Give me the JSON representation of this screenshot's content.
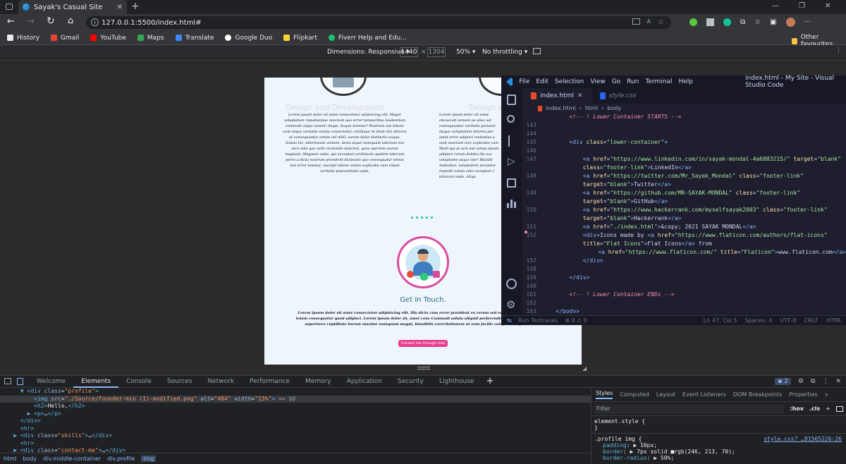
{
  "browser": {
    "tab_title": "Sayak's Casual Site",
    "url": "127.0.0.1:5500/index.html#",
    "bookmarks": [
      "History",
      "Gmail",
      "YouTube",
      "Maps",
      "Translate",
      "Google Duo",
      "Flipkart",
      "Fiverr Help and Edu..."
    ],
    "other_favourites": "Other favourites"
  },
  "device_toolbar": {
    "dimensions": "Dimensions: Responsive",
    "width": "1440",
    "times": "×",
    "height": "1304",
    "zoom": "50%",
    "throttling": "No throttling"
  },
  "page": {
    "card_title": "Design and Development",
    "card_title_right": "Design and",
    "card_text": "Lorem ipsum dolor sit amet consectetur adipisicing elit. Magni voluptatum repudiandae nesciunt quo error temporibus laudantium commodi atque autem! Sequi, itaque tenetur? Nostrum aut labore sunt atque veritatis soluta consectetur, similique in illum nisi dolores ut consequuntur omnis vel nihil, earum dolor distinctio eaque. Soluta hic, laboriosam veniam, dicta atque numquam laborum eos vero odio quo velit reiciendis dolorem, quos aperiam earum magnam. Magnam optio, qui excepturi architecto quidem laborum porro a dicta nostrum provident distinctio quo consequatur omnis nisi error tenetur, suscipit labore soluta explicabo cum totam veritatis praesentium unde.",
    "card_text_right": "Lorem ipsum dolor sit amet obcaecati veniam ea alias sol consequuntur veritatis pariatur itaque voluptatum dolores per amet error adipisci molestias a sunt nesciunt iure explicabo cum Modi qui at iure aut soluta ipsum adipisci rerum debitis illo exc voluptates atque iste? Blandit molestias, voluptatem providen impedit soluta odio excepturi r laborum unde. Aliqu",
    "contact_title": "Get In Touch.",
    "contact_text": "Lorem ipsum dolor sit amet consectetur adipisicing elit. Illo dicta cum error provident ea rerum sed eos ipsa, suscipit laborum totam consequatur quod adipisci. Lorem ipsum dolor sit, amet cons Commodi soluta aliquid perferendis aut, eos enim provident, asperiores cupiditate harum maxime numquam magni, blanditiis exercitationem ut eum facilis voluptatum ipsum dolor.",
    "contact_button": "Contact me through mail"
  },
  "vscode": {
    "menu": [
      "File",
      "Edit",
      "Selection",
      "View",
      "Go",
      "Run",
      "Terminal",
      "Help"
    ],
    "title": "index.html - My Site - Visual Studio Code",
    "tabs": [
      "index.html",
      "style.css"
    ],
    "breadcrumb": [
      "index.html",
      "html",
      "body"
    ],
    "lines": [
      {
        "n": "",
        "html": "<span class=\"cmt\">&lt;!-- ! Lower Container STARTS --&gt;</span>",
        "indent": 4
      },
      {
        "n": "143",
        "html": "",
        "indent": 0
      },
      {
        "n": "144",
        "html": "",
        "indent": 0
      },
      {
        "n": "145",
        "html": "<span class=\"tag\">&lt;div</span> <span class=\"attr\">class</span>=<span class=\"str\">\"lower-container\"</span><span class=\"tag\">&gt;</span>",
        "indent": 4
      },
      {
        "n": "146",
        "html": "",
        "indent": 0
      },
      {
        "n": "147",
        "html": "<span class=\"tag\">&lt;a</span> <span class=\"attr\">href</span>=<span class=\"str\">\"https://www.linkedin.com/in/sayak-mondal-4a6883215/\"</span> <span class=\"attr\">target</span>=<span class=\"str\">\"blank\"</span>",
        "indent": 6
      },
      {
        "n": "",
        "html": "<span class=\"attr\">class</span>=<span class=\"str\">\"footer-link\"</span><span class=\"tag\">&gt;</span>LinkedIn<span class=\"tag\">&lt;/a&gt;</span>",
        "indent": 6
      },
      {
        "n": "148",
        "html": "<span class=\"tag\">&lt;a</span> <span class=\"attr\">href</span>=<span class=\"str\">\"https://twitter.com/Mr_Sayak_Mondal\"</span> <span class=\"attr\">class</span>=<span class=\"str\">\"footer-link\"</span>",
        "indent": 6
      },
      {
        "n": "",
        "html": "<span class=\"attr\">target</span>=<span class=\"str\">\"blank\"</span><span class=\"tag\">&gt;</span>Twitter<span class=\"tag\">&lt;/a&gt;</span>",
        "indent": 6
      },
      {
        "n": "149",
        "html": "<span class=\"tag\">&lt;a</span> <span class=\"attr\">href</span>=<span class=\"str\">\"https://github.com/MR-SAYAK-MONDAL\"</span> <span class=\"attr\">class</span>=<span class=\"str\">\"footer-link\"</span>",
        "indent": 6
      },
      {
        "n": "",
        "html": "<span class=\"attr\">target</span>=<span class=\"str\">\"blank\"</span><span class=\"tag\">&gt;</span>GitHub<span class=\"tag\">&lt;/a&gt;</span>",
        "indent": 6
      },
      {
        "n": "150",
        "html": "<span class=\"tag\">&lt;a</span> <span class=\"attr\">href</span>=<span class=\"str\">\"https://www.hackerrank.com/myselfsayak2003\"</span> <span class=\"attr\">class</span>=<span class=\"str\">\"footer-link\"</span>",
        "indent": 6
      },
      {
        "n": "",
        "html": "<span class=\"attr\">target</span>=<span class=\"str\">\"blank\"</span><span class=\"tag\">&gt;</span>Hackerrank<span class=\"tag\">&lt;/a&gt;</span>",
        "indent": 6
      },
      {
        "n": "151",
        "html": "<span class=\"tag\">&lt;a</span> <span class=\"attr\">href</span>=<span class=\"str\">\"./index.html\"</span><span class=\"tag\">&gt;</span>&amp;copy; 2021 SAYAK MONDAL<span class=\"tag\">&lt;/a&gt;</span>",
        "indent": 6
      },
      {
        "n": "152",
        "html": "<span class=\"tag\">&lt;div&gt;</span>Icons made by <span class=\"tag\">&lt;a</span> <span class=\"attr\">href</span>=<span class=\"str\">\"https://www.flaticon.com/authors/flat-icons\"</span>",
        "indent": 6
      },
      {
        "n": "",
        "html": "<span class=\"attr\">title</span>=<span class=\"str\">\"Flat Icons\"</span><span class=\"tag\">&gt;</span>Flat Icons<span class=\"tag\">&lt;/a&gt;</span> from",
        "indent": 6
      },
      {
        "n": "",
        "html": "<span class=\"tag\">&lt;a</span> <span class=\"attr\">href</span>=<span class=\"str\">\"https://www.flaticon.com/\"</span> <span class=\"attr\">title</span>=<span class=\"str\">\"Flaticon\"</span><span class=\"tag\">&gt;</span>www.flaticon.com<span class=\"tag\">&lt;/a&gt;</span>",
        "indent": 9
      },
      {
        "n": "157",
        "html": "<span class=\"tag\">&lt;/div&gt;</span>",
        "indent": 6
      },
      {
        "n": "158",
        "html": "",
        "indent": 0
      },
      {
        "n": "159",
        "html": "<span class=\"tag\">&lt;/div&gt;</span>",
        "indent": 4
      },
      {
        "n": "160",
        "html": "",
        "indent": 0
      },
      {
        "n": "161",
        "html": "<span class=\"cmt\">&lt;!-- ! Lower Container ENDs --&gt;</span>",
        "indent": 4
      },
      {
        "n": "162",
        "html": "",
        "indent": 0
      },
      {
        "n": "163",
        "html": "<span class=\"tag\">&lt;/body&gt;</span>",
        "indent": 2
      }
    ],
    "status_run": "Run Testcases",
    "status_problems": "⊗ 0 ⚠ 0",
    "status_right": [
      "Ln 47, Col 5",
      "Spaces: 4",
      "UTF-8",
      "CRLF",
      "HTML"
    ]
  },
  "devtools": {
    "tabs": [
      "Welcome",
      "Elements",
      "Console",
      "Sources",
      "Network",
      "Performance",
      "Memory",
      "Application",
      "Security",
      "Lighthouse"
    ],
    "active_tab": "Elements",
    "issues_count": "2",
    "dom_lines": [
      {
        "indent": 3,
        "html": "<span class=\"dtg\">▼ &lt;div</span> <span class=\"dat\">class</span>=<span class=\"dav\">\"profile\"</span><span class=\"dtg\">&gt;</span>"
      },
      {
        "indent": 5,
        "html": "<span class=\"dtg\">&lt;img</span> <span class=\"dat\">src</span>=<span class=\"dav\">\"./Source/Founder-min (1)-modified.png\"</span> <span class=\"dat\">alt</span>=<span class=\"dav\">\"404\"</span> <span class=\"dat\">width</span>=<span class=\"dav\">\"15%\"</span><span class=\"dtg\">&gt;</span> <span style=\"color:#9aa0a6\">== $0</span>",
        "sel": true
      },
      {
        "indent": 5,
        "html": "<span class=\"dtg\">&lt;h2&gt;</span>Hello,<span class=\"dtg\">&lt;/h2&gt;</span>"
      },
      {
        "indent": 4,
        "html": "<span class=\"dtg\">▶ &lt;p&gt;</span>…<span class=\"dtg\">&lt;/p&gt;</span>"
      },
      {
        "indent": 3,
        "html": "<span class=\"dtg\">&lt;/div&gt;</span>"
      },
      {
        "indent": 3,
        "html": "<span class=\"dtg\">&lt;hr&gt;</span>"
      },
      {
        "indent": 2,
        "html": "<span class=\"dtg\">▶ &lt;div</span> <span class=\"dat\">class</span>=<span class=\"dav\">\"skills\"</span><span class=\"dtg\">&gt;</span>…<span class=\"dtg\">&lt;/div&gt;</span>"
      },
      {
        "indent": 3,
        "html": "<span class=\"dtg\">&lt;hr&gt;</span>"
      },
      {
        "indent": 2,
        "html": "<span class=\"dtg\">▶ &lt;div</span> <span class=\"dat\">class</span>=<span class=\"dav\">\"contact-me\"</span><span class=\"dtg\">&gt;</span>…<span class=\"dtg\">&lt;/div&gt;</span>"
      }
    ],
    "crumbs": [
      "html",
      "body",
      "div.middle-container",
      "div.profile",
      "img"
    ],
    "style_tabs": [
      "Styles",
      "Computed",
      "Layout",
      "Event Listeners",
      "DOM Breakpoints",
      "Properties"
    ],
    "filter_placeholder": "Filter",
    "hov": ":hov",
    "cls": ".cls",
    "element_style": "element.style {",
    "close_brace": "}",
    "rule_selector": ".profile img {",
    "rule_source": "style.css? …81565226:26",
    "rule_props": [
      {
        "name": "padding",
        "value": "▶ 10px;"
      },
      {
        "name": "border",
        "value": "▶ 7px solid ■rgb(246, 213, 70);"
      },
      {
        "name": "border-radius",
        "value": "▶ 50%;"
      }
    ]
  },
  "colors": {
    "accent_pink": "#e83e8c",
    "teal_dots": "#1abc9c",
    "vscode_bg": "#1e1e2e"
  }
}
